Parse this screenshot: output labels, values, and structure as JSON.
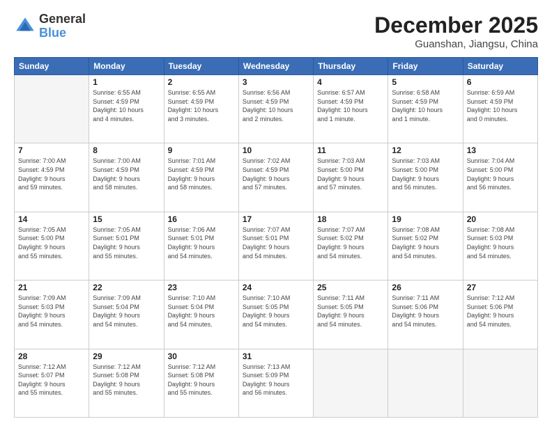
{
  "logo": {
    "general": "General",
    "blue": "Blue"
  },
  "header": {
    "month": "December 2025",
    "location": "Guanshan, Jiangsu, China"
  },
  "weekdays": [
    "Sunday",
    "Monday",
    "Tuesday",
    "Wednesday",
    "Thursday",
    "Friday",
    "Saturday"
  ],
  "weeks": [
    [
      {
        "day": "",
        "info": ""
      },
      {
        "day": "1",
        "info": "Sunrise: 6:55 AM\nSunset: 4:59 PM\nDaylight: 10 hours\nand 4 minutes."
      },
      {
        "day": "2",
        "info": "Sunrise: 6:55 AM\nSunset: 4:59 PM\nDaylight: 10 hours\nand 3 minutes."
      },
      {
        "day": "3",
        "info": "Sunrise: 6:56 AM\nSunset: 4:59 PM\nDaylight: 10 hours\nand 2 minutes."
      },
      {
        "day": "4",
        "info": "Sunrise: 6:57 AM\nSunset: 4:59 PM\nDaylight: 10 hours\nand 1 minute."
      },
      {
        "day": "5",
        "info": "Sunrise: 6:58 AM\nSunset: 4:59 PM\nDaylight: 10 hours\nand 1 minute."
      },
      {
        "day": "6",
        "info": "Sunrise: 6:59 AM\nSunset: 4:59 PM\nDaylight: 10 hours\nand 0 minutes."
      }
    ],
    [
      {
        "day": "7",
        "info": "Sunrise: 7:00 AM\nSunset: 4:59 PM\nDaylight: 9 hours\nand 59 minutes."
      },
      {
        "day": "8",
        "info": "Sunrise: 7:00 AM\nSunset: 4:59 PM\nDaylight: 9 hours\nand 58 minutes."
      },
      {
        "day": "9",
        "info": "Sunrise: 7:01 AM\nSunset: 4:59 PM\nDaylight: 9 hours\nand 58 minutes."
      },
      {
        "day": "10",
        "info": "Sunrise: 7:02 AM\nSunset: 4:59 PM\nDaylight: 9 hours\nand 57 minutes."
      },
      {
        "day": "11",
        "info": "Sunrise: 7:03 AM\nSunset: 5:00 PM\nDaylight: 9 hours\nand 57 minutes."
      },
      {
        "day": "12",
        "info": "Sunrise: 7:03 AM\nSunset: 5:00 PM\nDaylight: 9 hours\nand 56 minutes."
      },
      {
        "day": "13",
        "info": "Sunrise: 7:04 AM\nSunset: 5:00 PM\nDaylight: 9 hours\nand 56 minutes."
      }
    ],
    [
      {
        "day": "14",
        "info": "Sunrise: 7:05 AM\nSunset: 5:00 PM\nDaylight: 9 hours\nand 55 minutes."
      },
      {
        "day": "15",
        "info": "Sunrise: 7:05 AM\nSunset: 5:01 PM\nDaylight: 9 hours\nand 55 minutes."
      },
      {
        "day": "16",
        "info": "Sunrise: 7:06 AM\nSunset: 5:01 PM\nDaylight: 9 hours\nand 54 minutes."
      },
      {
        "day": "17",
        "info": "Sunrise: 7:07 AM\nSunset: 5:01 PM\nDaylight: 9 hours\nand 54 minutes."
      },
      {
        "day": "18",
        "info": "Sunrise: 7:07 AM\nSunset: 5:02 PM\nDaylight: 9 hours\nand 54 minutes."
      },
      {
        "day": "19",
        "info": "Sunrise: 7:08 AM\nSunset: 5:02 PM\nDaylight: 9 hours\nand 54 minutes."
      },
      {
        "day": "20",
        "info": "Sunrise: 7:08 AM\nSunset: 5:03 PM\nDaylight: 9 hours\nand 54 minutes."
      }
    ],
    [
      {
        "day": "21",
        "info": "Sunrise: 7:09 AM\nSunset: 5:03 PM\nDaylight: 9 hours\nand 54 minutes."
      },
      {
        "day": "22",
        "info": "Sunrise: 7:09 AM\nSunset: 5:04 PM\nDaylight: 9 hours\nand 54 minutes."
      },
      {
        "day": "23",
        "info": "Sunrise: 7:10 AM\nSunset: 5:04 PM\nDaylight: 9 hours\nand 54 minutes."
      },
      {
        "day": "24",
        "info": "Sunrise: 7:10 AM\nSunset: 5:05 PM\nDaylight: 9 hours\nand 54 minutes."
      },
      {
        "day": "25",
        "info": "Sunrise: 7:11 AM\nSunset: 5:05 PM\nDaylight: 9 hours\nand 54 minutes."
      },
      {
        "day": "26",
        "info": "Sunrise: 7:11 AM\nSunset: 5:06 PM\nDaylight: 9 hours\nand 54 minutes."
      },
      {
        "day": "27",
        "info": "Sunrise: 7:12 AM\nSunset: 5:06 PM\nDaylight: 9 hours\nand 54 minutes."
      }
    ],
    [
      {
        "day": "28",
        "info": "Sunrise: 7:12 AM\nSunset: 5:07 PM\nDaylight: 9 hours\nand 55 minutes."
      },
      {
        "day": "29",
        "info": "Sunrise: 7:12 AM\nSunset: 5:08 PM\nDaylight: 9 hours\nand 55 minutes."
      },
      {
        "day": "30",
        "info": "Sunrise: 7:12 AM\nSunset: 5:08 PM\nDaylight: 9 hours\nand 55 minutes."
      },
      {
        "day": "31",
        "info": "Sunrise: 7:13 AM\nSunset: 5:09 PM\nDaylight: 9 hours\nand 56 minutes."
      },
      {
        "day": "",
        "info": ""
      },
      {
        "day": "",
        "info": ""
      },
      {
        "day": "",
        "info": ""
      }
    ]
  ]
}
